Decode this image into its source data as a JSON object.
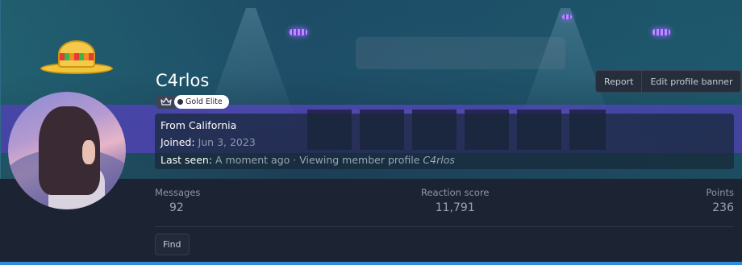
{
  "profile": {
    "username": "C4rlos",
    "badge": "Gold Elite",
    "location_prefix": "From ",
    "location": "California",
    "joined_label": "Joined:",
    "joined_value": "Jun 3, 2023",
    "last_seen_label": "Last seen:",
    "last_seen_value": "A moment ago · Viewing member profile",
    "last_seen_profile": "C4rlos"
  },
  "actions": {
    "report": "Report",
    "edit_banner": "Edit profile banner",
    "find": "Find"
  },
  "stats": [
    {
      "label": "Messages",
      "value": "92"
    },
    {
      "label": "Reaction score",
      "value": "11,791"
    },
    {
      "label": "Points",
      "value": "236"
    }
  ],
  "colors": {
    "background": "#1c2333",
    "accent": "#2f8de0",
    "badge_bg": "#ffffff"
  },
  "icons": {
    "badge_icon": "crown-icon",
    "avatar_accessory": "sombrero-icon"
  }
}
